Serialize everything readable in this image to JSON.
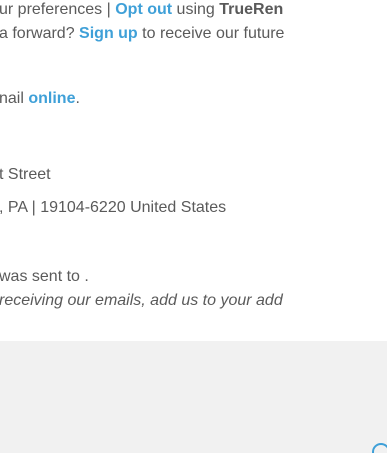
{
  "preferences_line": {
    "prefix": "ur preferences | ",
    "opt_out_link": "Opt out",
    "middle": " using ",
    "brand": "TrueRen"
  },
  "forward_line": {
    "prefix": "a forward? ",
    "sign_up_link": "Sign up",
    "suffix": " to receive our future"
  },
  "online_line": {
    "prefix": "nail ",
    "online_link": "online",
    "suffix": "."
  },
  "address": {
    "street": "t Street",
    "city_line": ", PA | 19104-6220 United States"
  },
  "sent_to_line": "was sent to .",
  "add_us_line": "receiving our emails, add us to your add",
  "colors": {
    "link": "#3fa0d8",
    "text": "#5a5a5a",
    "footer_bg": "#f1f1f1"
  }
}
